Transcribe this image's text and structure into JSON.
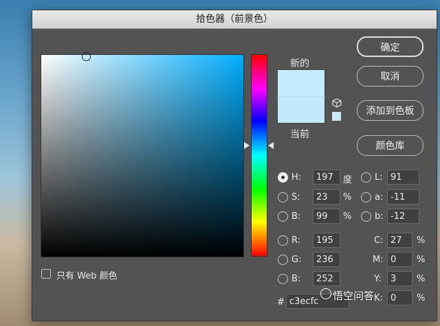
{
  "dialog": {
    "title": "拾色器（前景色）",
    "new_label": "新的",
    "current_label": "当前",
    "new_color": "#c3ecfc",
    "current_color": "#c3eafb"
  },
  "buttons": {
    "ok": "确定",
    "cancel": "取消",
    "add_to_swatches": "添加到色板",
    "color_libraries": "颜色库"
  },
  "hsb": {
    "h_label": "H:",
    "h_value": "197",
    "h_unit": "度",
    "s_label": "S:",
    "s_value": "23",
    "s_unit": "%",
    "b_label": "B:",
    "b_value": "99",
    "b_unit": "%"
  },
  "lab": {
    "l_label": "L:",
    "l_value": "91",
    "a_label": "a:",
    "a_value": "-11",
    "b_label": "b:",
    "b_value": "-12"
  },
  "rgb": {
    "r_label": "R:",
    "r_value": "195",
    "g_label": "G:",
    "g_value": "236",
    "b_label": "B:",
    "b_value": "252"
  },
  "cmyk": {
    "c_label": "C:",
    "c_value": "27",
    "m_label": "M:",
    "m_value": "0",
    "y_label": "Y:",
    "y_value": "3",
    "k_label": "K:",
    "k_value": "0",
    "unit": "%"
  },
  "hex": {
    "label": "#",
    "value": "c3ecfc"
  },
  "web_only": {
    "label": "只有 Web 颜色",
    "checked": false
  },
  "watermark": "悟空问答",
  "icons": [
    "cube-icon",
    "radio-selected",
    "checkbox"
  ]
}
